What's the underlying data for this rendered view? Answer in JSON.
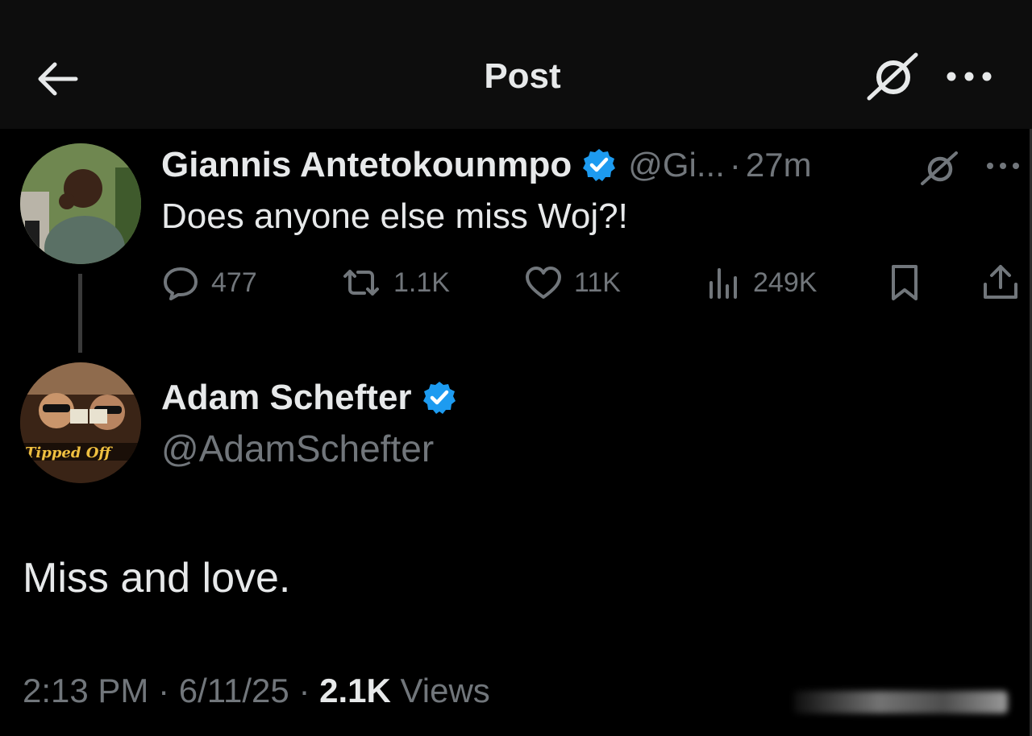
{
  "header": {
    "title": "Post",
    "back_icon": "arrow-left-icon",
    "grok_icon": "grok-icon",
    "more_icon": "more-horizontal-icon"
  },
  "parent_post": {
    "display_name": "Giannis Antetokounmpo",
    "verified": true,
    "handle": "@Gi...",
    "separator": "·",
    "time": "27m",
    "text": "Does anyone else miss Woj?!",
    "stats": {
      "replies": "477",
      "reposts": "1.1K",
      "likes": "11K",
      "views": "249K"
    }
  },
  "reply_post": {
    "display_name": "Adam Schefter",
    "verified": true,
    "handle": "@AdamSchefter",
    "text": "Miss and love.",
    "time": "2:13 PM",
    "sep1": "·",
    "date": "6/11/25",
    "sep2": "·",
    "views_count": "2.1K",
    "views_label": "Views"
  },
  "colors": {
    "background": "#000000",
    "header_background": "#0d0d0d",
    "primary_text": "#e7e9ea",
    "secondary_text": "#71767b",
    "verified_blue": "#1d9bf0"
  }
}
